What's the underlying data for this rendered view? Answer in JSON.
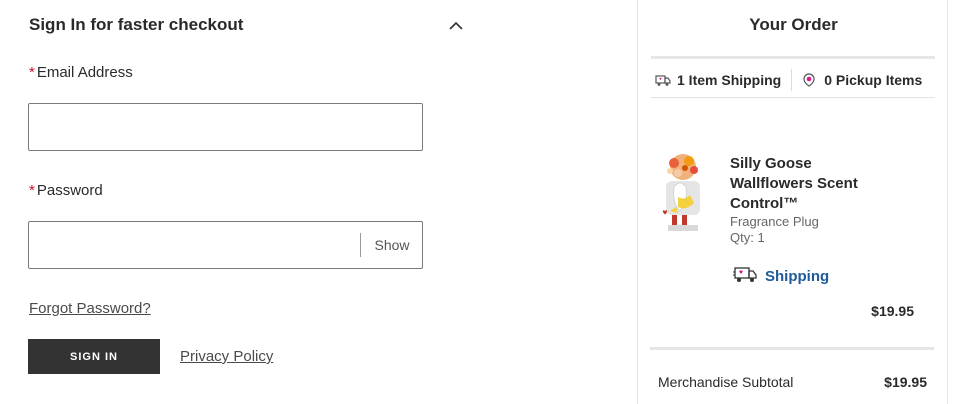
{
  "signin": {
    "title": "Sign In for faster checkout",
    "email_label": "Email Address",
    "email_value": "",
    "password_label": "Password",
    "password_value": "",
    "show_label": "Show",
    "forgot_label": "Forgot Password?",
    "signin_button": "SIGN IN",
    "privacy_label": "Privacy Policy",
    "required_mark": "*"
  },
  "order": {
    "title": "Your Order",
    "tab_shipping": "1 Item Shipping",
    "tab_pickup": "0 Pickup Items",
    "item": {
      "name": "Silly Goose Wallflowers Scent Control™",
      "type": "Fragrance Plug",
      "qty": "Qty: 1",
      "shipping_method": "Shipping",
      "price": "$19.95",
      "image_icon": "product-thumbnail"
    },
    "subtotal_label": "Merchandise Subtotal",
    "subtotal_value": "$19.95"
  },
  "colors": {
    "required": "#c8102e",
    "button_bg": "#333333",
    "link_blue": "#1f5a9a",
    "accent_pink": "#d81b8c"
  }
}
